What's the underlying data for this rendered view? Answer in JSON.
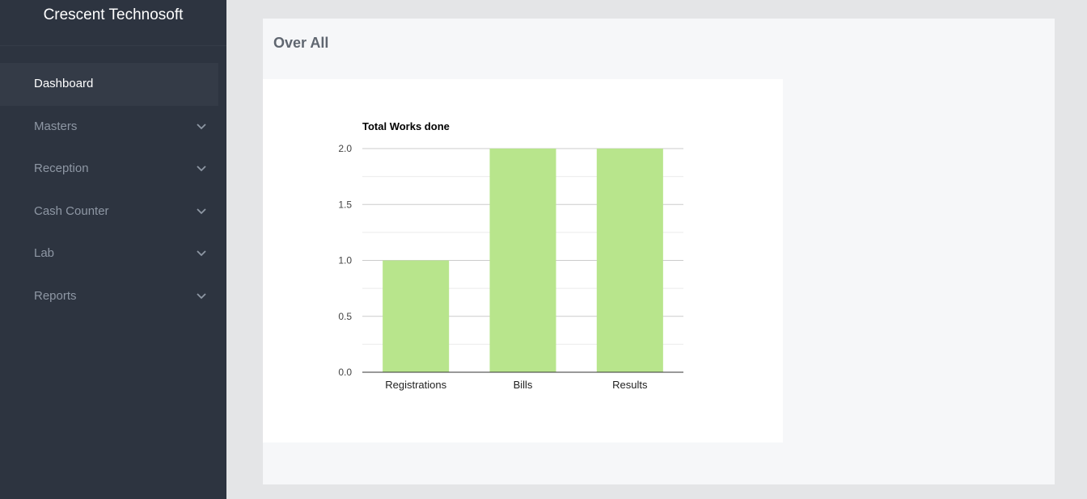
{
  "app": {
    "brand": "Crescent Technosoft"
  },
  "sidebar": {
    "items": [
      {
        "label": "Dashboard"
      },
      {
        "label": "Masters"
      },
      {
        "label": "Reception"
      },
      {
        "label": "Cash Counter"
      },
      {
        "label": "Lab"
      },
      {
        "label": "Reports"
      }
    ]
  },
  "main": {
    "panel_title": "Over All"
  },
  "colors": {
    "sidebar_bg": "#2d3440",
    "bar": "#b8e58c"
  },
  "chart_data": {
    "type": "bar",
    "title": "Total Works done",
    "categories": [
      "Registrations",
      "Bills",
      "Results"
    ],
    "values": [
      1,
      2,
      2
    ],
    "ylim": [
      0,
      2
    ],
    "yticks": [
      "0.0",
      "0.5",
      "1.0",
      "1.5",
      "2.0"
    ],
    "grid": true,
    "xlabel": "",
    "ylabel": ""
  }
}
